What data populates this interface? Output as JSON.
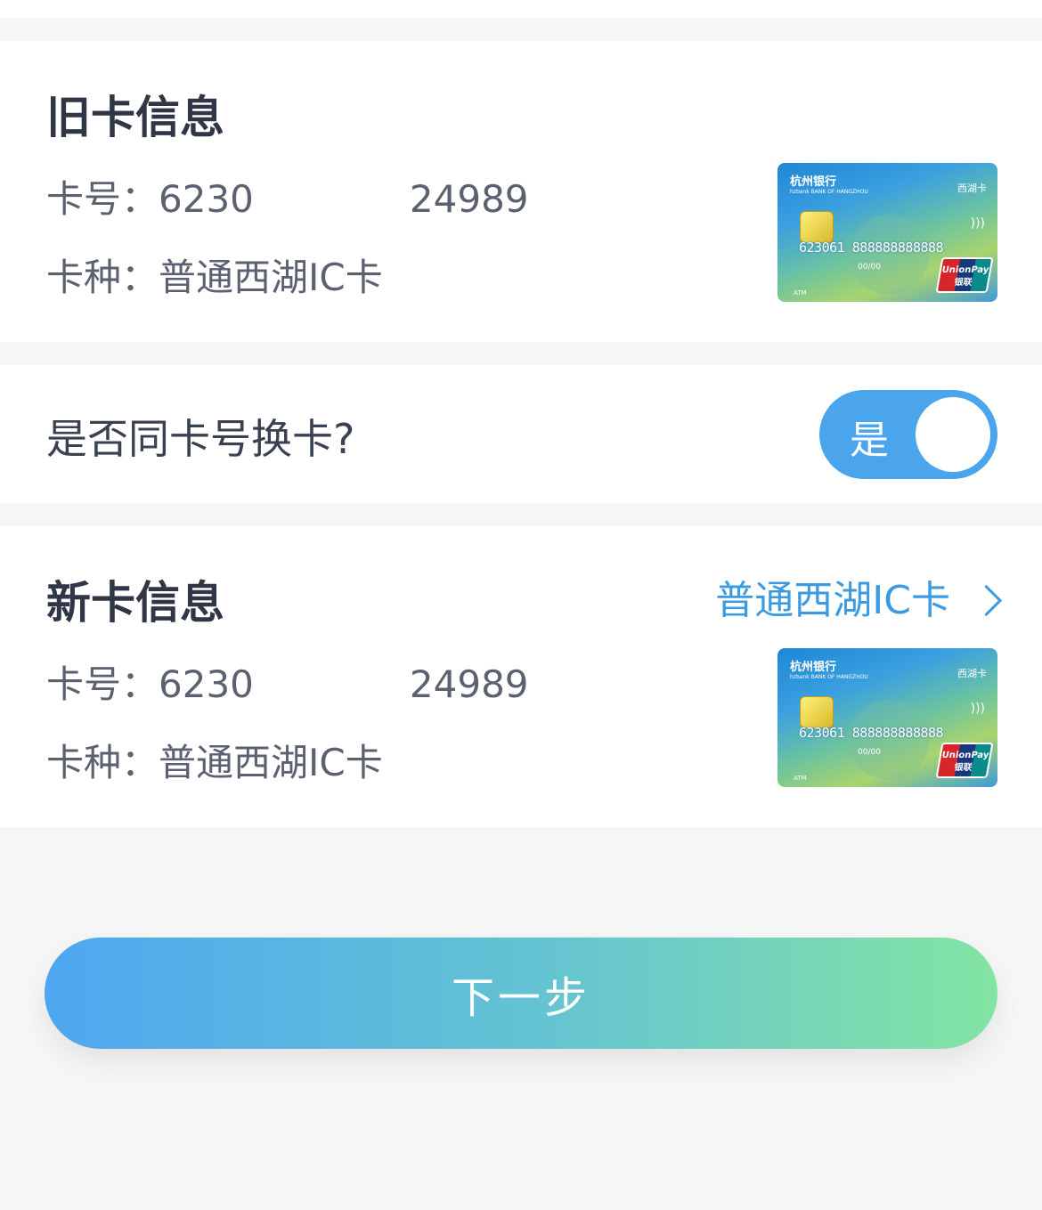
{
  "old_card": {
    "title": "旧卡信息",
    "number_label": "卡号：",
    "number_prefix": "6230",
    "number_suffix": "24989",
    "type_label": "卡种：",
    "type_value": "普通西湖IC卡"
  },
  "same_number": {
    "question": "是否同卡号换卡?",
    "toggle_label": "是",
    "toggle_on": true,
    "toggle_color": "#4aa5ec"
  },
  "new_card": {
    "title": "新卡信息",
    "type_link": "普通西湖IC卡",
    "number_label": "卡号：",
    "number_prefix": "6230",
    "number_suffix": "24989",
    "type_label": "卡种：",
    "type_value": "普通西湖IC卡"
  },
  "card_image": {
    "bank_name": "杭州银行",
    "bank_en": "hzbank  BANK OF HANGZHOU",
    "card_name": "西湖卡",
    "card_number": "623061 888888888888",
    "valid": "00/00",
    "unionpay": "UnionPay 银联",
    "atm": "ATM"
  },
  "next_button": {
    "label": "下一步"
  }
}
